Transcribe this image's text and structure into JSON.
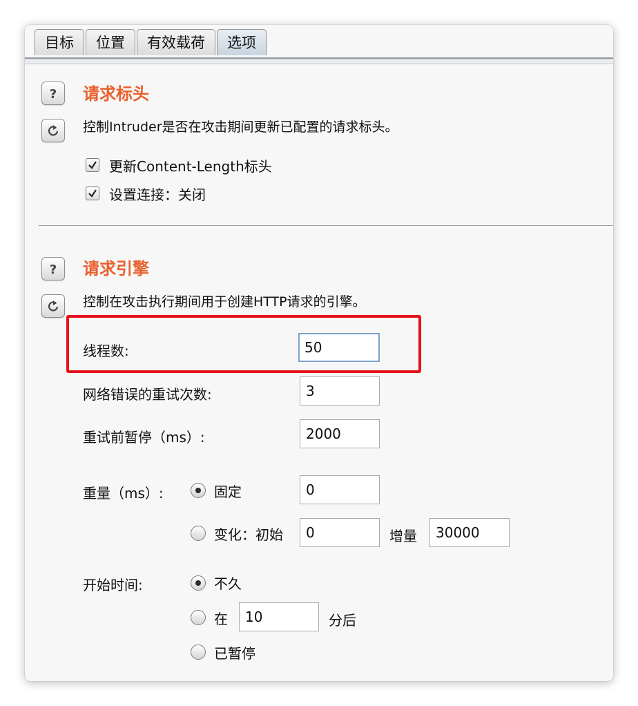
{
  "tabs": [
    {
      "label": "目标",
      "active": false
    },
    {
      "label": "位置",
      "active": false
    },
    {
      "label": "有效载荷",
      "active": false
    },
    {
      "label": "选项",
      "active": true
    }
  ],
  "icons": {
    "help": "help-icon",
    "reset": "reset-icon"
  },
  "colors": {
    "section_title": "#e9602c",
    "highlight": "#e5131b",
    "focus": "#7da2ce"
  },
  "request_headers": {
    "title": "请求标头",
    "description": "控制Intruder是否在攻击期间更新已配置的请求标头。",
    "options": [
      {
        "label": "更新Content-Length标头",
        "checked": true
      },
      {
        "label": "设置连接：关闭",
        "checked": true
      }
    ]
  },
  "request_engine": {
    "title": "请求引擎",
    "description": "控制在攻击执行期间用于创建HTTP请求的引擎。",
    "threads": {
      "label": "线程数:",
      "value": "50"
    },
    "retries": {
      "label": "网络错误的重试次数:",
      "value": "3"
    },
    "pause": {
      "label": "重试前暂停（ms）:",
      "value": "2000"
    },
    "throttle": {
      "label": "重量（ms）:",
      "fixed": {
        "label": "固定",
        "value": "0",
        "selected": true
      },
      "variable": {
        "label": "变化：初始",
        "value": "0",
        "selected": false,
        "increment_label": "增量",
        "increment_value": "30000"
      }
    },
    "start_time": {
      "label": "开始时间:",
      "soon": {
        "label": "不久",
        "selected": true
      },
      "in": {
        "label": "在",
        "value": "10",
        "suffix": "分后",
        "selected": false
      },
      "paused": {
        "label": "已暂停",
        "selected": false
      }
    }
  }
}
